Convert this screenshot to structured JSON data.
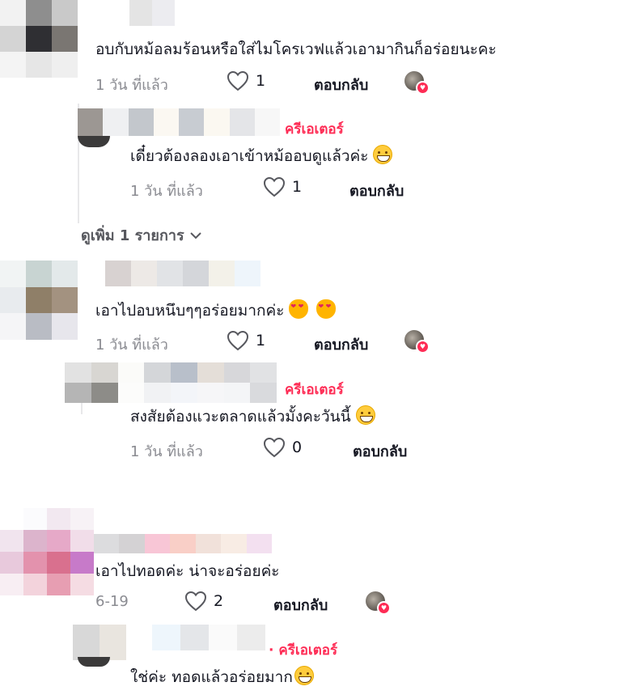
{
  "comments": [
    {
      "text": "อบกับหม้อลมร้อนหรือใส่ไมโครเวฟแล้วเอามากินก็อร่อยนะคะ",
      "time": "1 วัน ที่แล้ว",
      "likes": "1",
      "reply_label": "ตอบกลับ",
      "liked_by_author": true,
      "replies": [
        {
          "creator_label": "ครีเอเตอร์",
          "text": "เดี๋ยวต้องลองเอาเข้าหม้ออบดูแล้วค่ะ",
          "emoji": "grin-icon",
          "time": "1 วัน ที่แล้ว",
          "likes": "1",
          "reply_label": "ตอบกลับ"
        }
      ],
      "see_more": "ดูเพิ่ม 1 รายการ"
    },
    {
      "text": "เอาไปอบหนึบๆๆอร่อยมากค่ะ",
      "emoji": "heart-eyes-cat-icon",
      "time": "1 วัน ที่แล้ว",
      "likes": "1",
      "reply_label": "ตอบกลับ",
      "liked_by_author": true,
      "replies": [
        {
          "creator_label": "ครีเอเตอร์",
          "text": "สงสัยต้องแวะตลาดแล้วมั้งคะวันนี้",
          "emoji": "grin-icon",
          "time": "1 วัน ที่แล้ว",
          "likes": "0",
          "reply_label": "ตอบกลับ"
        }
      ]
    },
    {
      "text": "เอาไปทอดค่ะ น่าจะอร่อยค่ะ",
      "time": "6-19",
      "likes": "2",
      "reply_label": "ตอบกลับ",
      "liked_by_author": true,
      "replies": [
        {
          "creator_label": "· ครีเอเตอร์",
          "text": "ใช่ค่ะ ทอดแล้วอร่อยมาก",
          "emoji": "grin-icon"
        }
      ]
    }
  ],
  "colors": {
    "creator": "#fe2c55",
    "meta": "#8a8b91",
    "text": "#161823",
    "divider": "#e8e8ea"
  }
}
